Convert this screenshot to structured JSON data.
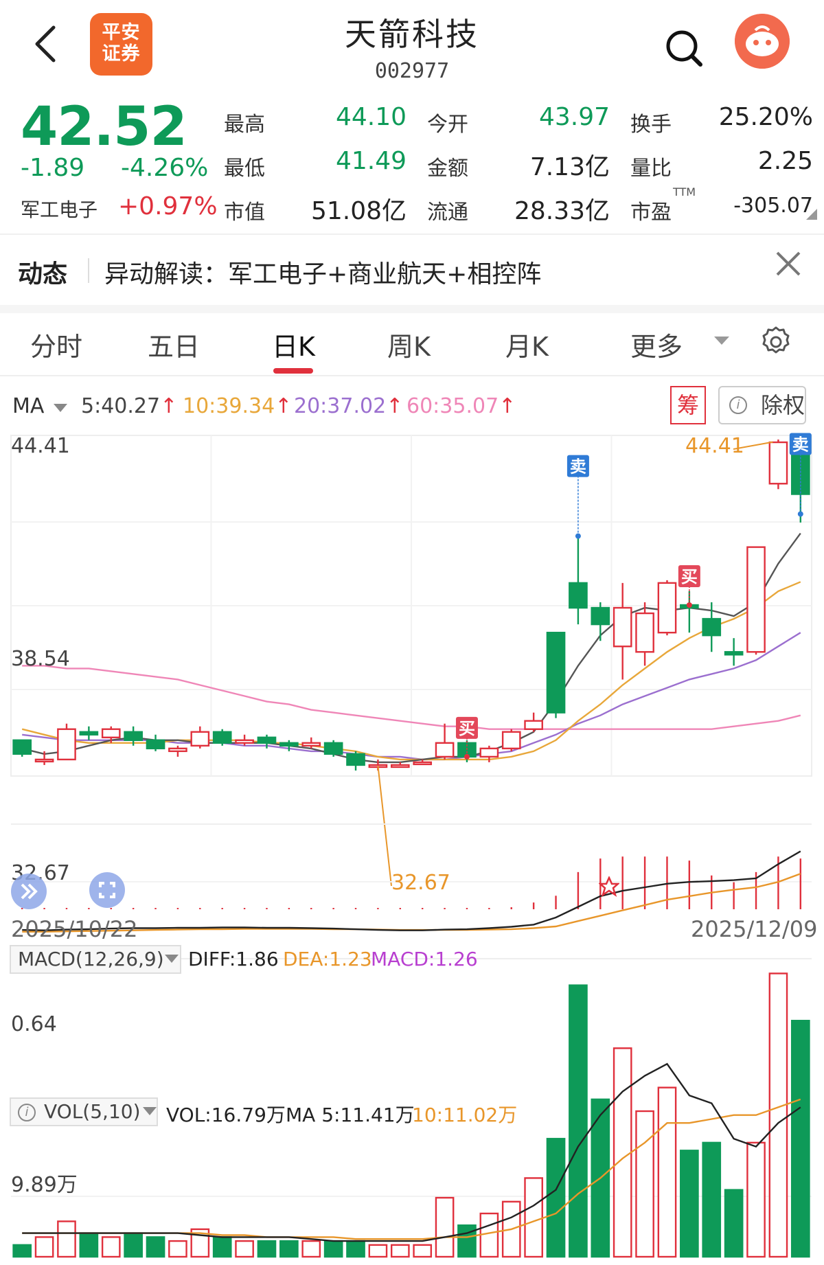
{
  "header": {
    "title": "天箭科技",
    "code": "002977",
    "brand_line1": "平安",
    "brand_line2": "证券"
  },
  "quote": {
    "price": "42.52",
    "change": "-1.89",
    "change_pct": "-4.26%",
    "sector_name": "军工电子",
    "sector_pct": "+0.97%",
    "items": [
      {
        "label": "最高",
        "value": "44.10"
      },
      {
        "label": "今开",
        "value": "43.97"
      },
      {
        "label": "换手",
        "value": "25.20%"
      },
      {
        "label": "最低",
        "value": "41.49"
      },
      {
        "label": "金额",
        "value": "7.13亿"
      },
      {
        "label": "量比",
        "value": "2.25"
      },
      {
        "label": "市值",
        "value": "51.08亿"
      },
      {
        "label": "流通",
        "value": "28.33亿"
      },
      {
        "label": "市盈",
        "value": "-305.07",
        "sup": "TTM"
      }
    ]
  },
  "news": {
    "tag": "动态",
    "text": "异动解读：军工电子+商业航天+相控阵"
  },
  "tabs": [
    "分时",
    "五日",
    "日K",
    "周K",
    "月K",
    "更多"
  ],
  "active_tab": "日K",
  "ma": {
    "label": "MA",
    "items": [
      {
        "text": "5:40.27",
        "color": "#444444"
      },
      {
        "text": "10:39.34",
        "color": "#e8a73a"
      },
      {
        "text": "20:37.02",
        "color": "#9b6fcf"
      },
      {
        "text": "60:35.07",
        "color": "#ef86b7"
      }
    ],
    "chou": "筹",
    "chuquan": "除权"
  },
  "kline": {
    "top_label": "44.41",
    "mid_label": "38.54",
    "bottom_label": "32.67",
    "high_mark": "44.41",
    "low_mark": "32.67",
    "date_start": "2025/10/22",
    "date_end": "2025/12/09",
    "buy_label": "买",
    "sell_label": "卖"
  },
  "macd": {
    "name": "MACD(12,26,9)",
    "diff": "DIFF:1.86",
    "dea": "DEA:1.23",
    "macd": "MACD:1.26",
    "axis_label": "0.64"
  },
  "vol": {
    "name": "VOL(5,10)",
    "vol": "VOL:16.79万",
    "ma5": "MA 5:11.41万",
    "ma10": "10:11.02万",
    "axis_label": "9.89万"
  },
  "colors": {
    "up": "#e0303c",
    "down": "#0e9a58",
    "accent": "#f2682c"
  },
  "chart_data": {
    "type": "candlestick",
    "ylim": [
      32.67,
      44.41
    ],
    "candles": [
      {
        "o": 33.6,
        "c": 33.1,
        "h": 33.6,
        "l": 33.0
      },
      {
        "o": 32.9,
        "c": 32.9,
        "h": 33.2,
        "l": 32.7
      },
      {
        "o": 32.9,
        "c": 34.0,
        "h": 34.2,
        "l": 32.9
      },
      {
        "o": 33.9,
        "c": 33.8,
        "h": 34.1,
        "l": 33.6
      },
      {
        "o": 33.7,
        "c": 34.0,
        "h": 34.1,
        "l": 33.5
      },
      {
        "o": 33.9,
        "c": 33.6,
        "h": 34.1,
        "l": 33.4
      },
      {
        "o": 33.6,
        "c": 33.3,
        "h": 33.8,
        "l": 33.2
      },
      {
        "o": 33.2,
        "c": 33.3,
        "h": 33.4,
        "l": 33.0
      },
      {
        "o": 33.4,
        "c": 33.9,
        "h": 34.1,
        "l": 33.3
      },
      {
        "o": 33.9,
        "c": 33.5,
        "h": 34.0,
        "l": 33.4
      },
      {
        "o": 33.5,
        "c": 33.6,
        "h": 33.8,
        "l": 33.4
      },
      {
        "o": 33.7,
        "c": 33.5,
        "h": 33.8,
        "l": 33.3
      },
      {
        "o": 33.5,
        "c": 33.4,
        "h": 33.6,
        "l": 33.2
      },
      {
        "o": 33.4,
        "c": 33.5,
        "h": 33.7,
        "l": 33.3
      },
      {
        "o": 33.5,
        "c": 33.1,
        "h": 33.6,
        "l": 33.0
      },
      {
        "o": 33.1,
        "c": 32.7,
        "h": 33.2,
        "l": 32.5
      },
      {
        "o": 32.7,
        "c": 32.7,
        "h": 32.9,
        "l": 32.5
      },
      {
        "o": 32.7,
        "c": 32.7,
        "h": 32.8,
        "l": 32.6
      },
      {
        "o": 32.8,
        "c": 32.8,
        "h": 32.9,
        "l": 32.7
      },
      {
        "o": 33.0,
        "c": 33.5,
        "h": 34.2,
        "l": 32.9
      },
      {
        "o": 33.5,
        "c": 33.0,
        "h": 33.6,
        "l": 32.8
      },
      {
        "o": 33.0,
        "c": 33.3,
        "h": 33.4,
        "l": 32.8
      },
      {
        "o": 33.3,
        "c": 33.9,
        "h": 34.0,
        "l": 33.2
      },
      {
        "o": 34.0,
        "c": 34.3,
        "h": 34.6,
        "l": 33.9
      },
      {
        "o": 37.5,
        "c": 34.6,
        "h": 37.5,
        "l": 34.4
      },
      {
        "o": 39.3,
        "c": 38.4,
        "h": 41.0,
        "l": 37.8
      },
      {
        "o": 38.4,
        "c": 37.8,
        "h": 38.6,
        "l": 37.2
      },
      {
        "o": 37.0,
        "c": 38.4,
        "h": 39.3,
        "l": 35.8
      },
      {
        "o": 36.8,
        "c": 38.2,
        "h": 38.6,
        "l": 36.3
      },
      {
        "o": 37.5,
        "c": 39.3,
        "h": 39.4,
        "l": 37.4
      },
      {
        "o": 38.5,
        "c": 38.4,
        "h": 39.0,
        "l": 37.5
      },
      {
        "o": 38.0,
        "c": 37.4,
        "h": 38.6,
        "l": 36.8
      },
      {
        "o": 36.8,
        "c": 36.7,
        "h": 37.3,
        "l": 36.3
      },
      {
        "o": 36.8,
        "c": 40.6,
        "h": 40.6,
        "l": 36.7
      },
      {
        "o": 42.9,
        "c": 44.4,
        "h": 44.5,
        "l": 42.7
      },
      {
        "o": 43.97,
        "c": 42.52,
        "h": 44.1,
        "l": 41.49
      }
    ],
    "ma5": [
      33.3,
      33.1,
      33.2,
      33.4,
      33.6,
      33.7,
      33.6,
      33.6,
      33.5,
      33.5,
      33.5,
      33.5,
      33.4,
      33.3,
      33.1,
      32.9,
      32.8,
      32.8,
      32.9,
      33.0,
      33.0,
      33.2,
      33.5,
      33.9,
      35.0,
      36.3,
      37.4,
      38.1,
      38.4,
      38.3,
      38.4,
      38.3,
      38.1,
      38.6,
      40.0,
      41.1
    ],
    "ma10": [
      34.0,
      33.8,
      33.6,
      33.5,
      33.5,
      33.5,
      33.5,
      33.6,
      33.6,
      33.6,
      33.6,
      33.5,
      33.5,
      33.4,
      33.3,
      33.2,
      33.0,
      32.9,
      32.9,
      32.9,
      32.9,
      32.9,
      33.0,
      33.2,
      33.6,
      34.3,
      34.9,
      35.6,
      36.2,
      36.8,
      37.3,
      37.7,
      38.0,
      38.4,
      39.0,
      39.34
    ],
    "ma20": [
      33.8,
      33.7,
      33.6,
      33.6,
      33.6,
      33.6,
      33.6,
      33.5,
      33.5,
      33.5,
      33.4,
      33.4,
      33.3,
      33.2,
      33.2,
      33.1,
      33.0,
      33.0,
      32.9,
      32.9,
      33.0,
      33.1,
      33.2,
      33.5,
      33.8,
      34.2,
      34.5,
      34.9,
      35.2,
      35.5,
      35.8,
      36.0,
      36.2,
      36.5,
      37.0,
      37.5
    ],
    "ma60": [
      36.3,
      36.3,
      36.2,
      36.2,
      36.1,
      36.0,
      35.9,
      35.8,
      35.6,
      35.4,
      35.2,
      35.0,
      34.9,
      34.7,
      34.6,
      34.5,
      34.4,
      34.3,
      34.2,
      34.1,
      34.1,
      34.0,
      34.0,
      34.0,
      34.0,
      34.0,
      34.0,
      34.0,
      34.0,
      34.0,
      34.0,
      34.0,
      34.1,
      34.2,
      34.3,
      34.5
    ],
    "signals": [
      {
        "index": 20,
        "type": "buy",
        "price": 33.0
      },
      {
        "index": 25,
        "type": "sell",
        "price": 41.0
      },
      {
        "index": 30,
        "type": "buy",
        "price": 38.5
      },
      {
        "index": 35,
        "type": "sell",
        "price": 41.8
      }
    ],
    "macd_hist": [
      0.02,
      0.02,
      0.02,
      0.02,
      0.02,
      0.02,
      0.02,
      0.02,
      0.02,
      0.02,
      0.02,
      0.02,
      0.02,
      0.02,
      0.02,
      0.02,
      0.02,
      0.02,
      0.02,
      0.02,
      0.02,
      0.02,
      0.03,
      0.1,
      0.2,
      0.55,
      0.75,
      0.78,
      0.78,
      0.78,
      0.72,
      0.5,
      0.4,
      0.55,
      0.78,
      0.75
    ],
    "macd_diff": [
      -0.35,
      -0.36,
      -0.34,
      -0.33,
      -0.31,
      -0.3,
      -0.3,
      -0.29,
      -0.29,
      -0.28,
      -0.28,
      -0.29,
      -0.29,
      -0.3,
      -0.31,
      -0.33,
      -0.35,
      -0.36,
      -0.36,
      -0.34,
      -0.33,
      -0.3,
      -0.26,
      -0.2,
      0.0,
      0.3,
      0.6,
      0.75,
      0.85,
      0.95,
      1.0,
      1.02,
      1.05,
      1.1,
      1.5,
      1.86
    ],
    "macd_dea": [
      -0.4,
      -0.4,
      -0.39,
      -0.38,
      -0.37,
      -0.36,
      -0.35,
      -0.34,
      -0.33,
      -0.33,
      -0.32,
      -0.32,
      -0.32,
      -0.32,
      -0.33,
      -0.33,
      -0.34,
      -0.35,
      -0.35,
      -0.35,
      -0.35,
      -0.34,
      -0.33,
      -0.3,
      -0.25,
      -0.1,
      0.05,
      0.2,
      0.35,
      0.5,
      0.6,
      0.7,
      0.78,
      0.85,
      1.0,
      1.23
    ],
    "volume": [
      0.3,
      0.5,
      0.9,
      0.6,
      0.5,
      0.6,
      0.5,
      0.4,
      0.7,
      0.5,
      0.4,
      0.4,
      0.4,
      0.4,
      0.4,
      0.4,
      0.3,
      0.3,
      0.3,
      1.5,
      0.8,
      1.1,
      1.4,
      2.0,
      3.0,
      6.9,
      4.0,
      5.3,
      3.7,
      4.3,
      2.7,
      2.9,
      1.7,
      2.9,
      7.2,
      6.0
    ],
    "vol_ma5": [
      0.6,
      0.6,
      0.6,
      0.6,
      0.6,
      0.6,
      0.6,
      0.6,
      0.55,
      0.5,
      0.5,
      0.5,
      0.5,
      0.45,
      0.4,
      0.4,
      0.4,
      0.4,
      0.4,
      0.5,
      0.6,
      0.8,
      1.0,
      1.3,
      1.7,
      2.8,
      3.6,
      4.2,
      4.6,
      4.9,
      4.1,
      3.9,
      3.0,
      2.8,
      3.4,
      3.8
    ],
    "vol_ma10": [
      0.6,
      0.6,
      0.6,
      0.6,
      0.6,
      0.6,
      0.6,
      0.6,
      0.6,
      0.55,
      0.55,
      0.5,
      0.5,
      0.5,
      0.5,
      0.45,
      0.45,
      0.45,
      0.45,
      0.5,
      0.5,
      0.6,
      0.7,
      0.9,
      1.1,
      1.6,
      2.0,
      2.5,
      2.9,
      3.4,
      3.4,
      3.5,
      3.6,
      3.6,
      3.8,
      4.0
    ]
  }
}
